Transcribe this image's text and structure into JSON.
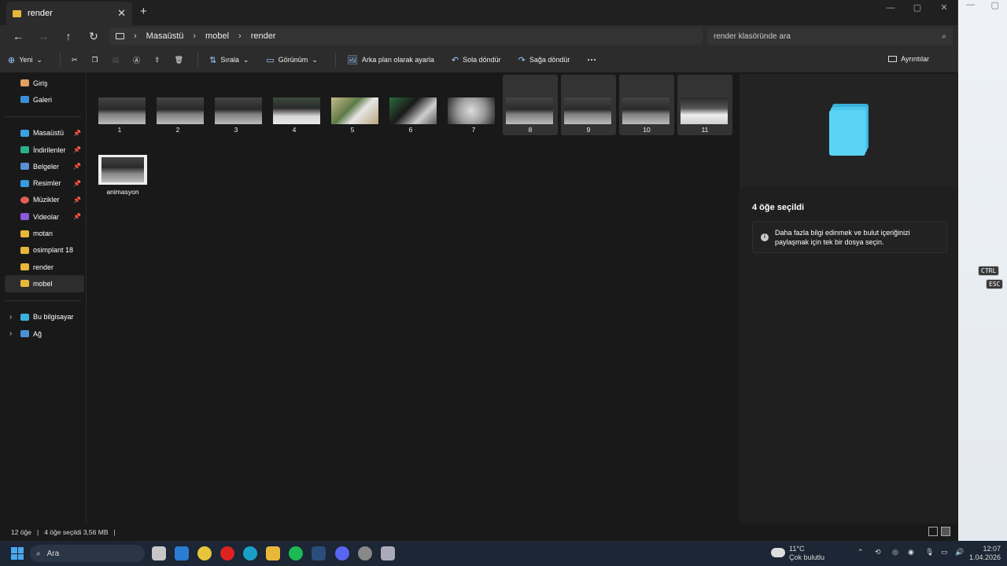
{
  "window": {
    "tab_title": "render",
    "new_tab_symbol": "+",
    "close_symbol": "✕"
  },
  "address": {
    "crumbs": [
      "Masaüstü",
      "mobel",
      "render"
    ],
    "search_placeholder": "render klasöründe ara"
  },
  "toolbar": {
    "new_label": "Yeni",
    "sort_label": "Sırala",
    "view_label": "Görünüm",
    "set_background_label": "Arka plan olarak ayarla",
    "rotate_left_label": "Sola döndür",
    "rotate_right_label": "Sağa döndür",
    "more_symbol": "···",
    "details_label": "Ayrıntılar"
  },
  "sidebar": {
    "items": [
      {
        "label": "Giriş",
        "icon": "home-icon"
      },
      {
        "label": "Galeri",
        "icon": "gallery-icon"
      },
      {
        "label": "Masaüstü",
        "icon": "desktop-icon",
        "pinned": true
      },
      {
        "label": "İndirilenler",
        "icon": "download-icon",
        "pinned": true
      },
      {
        "label": "Belgeler",
        "icon": "documents-icon",
        "pinned": true
      },
      {
        "label": "Resimler",
        "icon": "pictures-icon",
        "pinned": true
      },
      {
        "label": "Müzikler",
        "icon": "music-icon",
        "pinned": true
      },
      {
        "label": "Videolar",
        "icon": "videos-icon",
        "pinned": true
      },
      {
        "label": "motan",
        "icon": "folder-icon"
      },
      {
        "label": "osimplant 18",
        "icon": "folder-icon"
      },
      {
        "label": "render",
        "icon": "folder-icon"
      },
      {
        "label": "mobel",
        "icon": "folder-icon",
        "active": true
      },
      {
        "label": "Bu bilgisayar",
        "icon": "computer-icon"
      },
      {
        "label": "Ağ",
        "icon": "network-icon"
      }
    ]
  },
  "files": {
    "items": [
      {
        "name": "1",
        "selected": false
      },
      {
        "name": "2",
        "selected": false
      },
      {
        "name": "3",
        "selected": false
      },
      {
        "name": "4",
        "selected": false
      },
      {
        "name": "5",
        "selected": false
      },
      {
        "name": "6",
        "selected": false
      },
      {
        "name": "7",
        "selected": false
      },
      {
        "name": "8",
        "selected": true
      },
      {
        "name": "9",
        "selected": true
      },
      {
        "name": "10",
        "selected": true
      },
      {
        "name": "11",
        "selected": true
      }
    ],
    "video_name": "animasyon"
  },
  "details": {
    "title": "4 öğe seçildi",
    "info_line1": "Daha fazla bilgi edinmek ve bulut içeriğinizi",
    "info_line2": "paylaşmak için tek bir dosya seçin."
  },
  "status": {
    "count": "12 öğe",
    "selection": "4 öğe seçildi  3,56 MB"
  },
  "desktop": {
    "key_ctrl": "CTRL",
    "key_esc": "ESC"
  },
  "taskbar": {
    "search_label": "Ara",
    "temperature": "11°C",
    "weather": "Çok bulutlu",
    "time": "12:07",
    "date": "1.04.2026"
  }
}
